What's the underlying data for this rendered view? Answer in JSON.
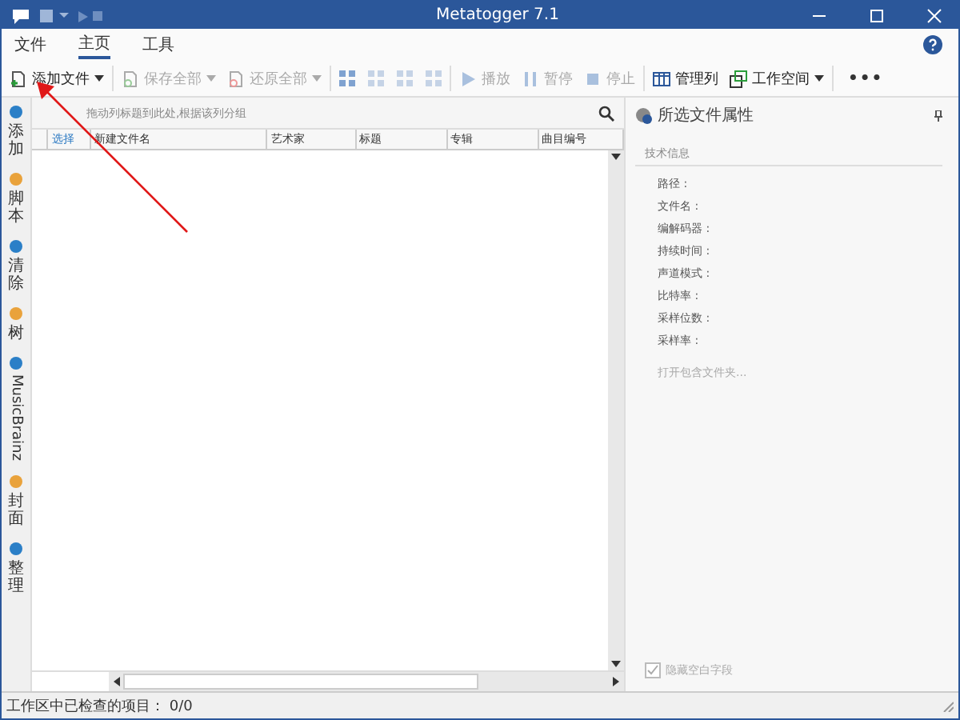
{
  "window": {
    "title": "Metatogger 7.1"
  },
  "menu_tabs": [
    {
      "label": "文件",
      "selected": false
    },
    {
      "label": "主页",
      "selected": true
    },
    {
      "label": "工具",
      "selected": false
    }
  ],
  "toolbar": [
    {
      "kind": "button",
      "label": "添加文件",
      "dropdown": true,
      "disabled": false
    },
    {
      "kind": "button",
      "label": "保存全部",
      "dropdown": true,
      "disabled": true
    },
    {
      "kind": "button",
      "label": "还原全部",
      "dropdown": true,
      "disabled": true
    },
    {
      "kind": "grid"
    },
    {
      "kind": "button",
      "label": "播放",
      "dropdown": false,
      "disabled": true
    },
    {
      "kind": "button",
      "label": "暂停",
      "dropdown": false,
      "disabled": true
    },
    {
      "kind": "button",
      "label": "停止",
      "dropdown": false,
      "disabled": true
    },
    {
      "kind": "button",
      "label": "管理列",
      "dropdown": false,
      "disabled": false
    },
    {
      "kind": "button",
      "label": "工作空间",
      "dropdown": true,
      "disabled": false
    },
    {
      "kind": "more",
      "label": "•••"
    }
  ],
  "sidebar": [
    {
      "label": "添加",
      "kind": "cjk"
    },
    {
      "label": "脚本",
      "kind": "cjk"
    },
    {
      "label": "清除",
      "kind": "cjk"
    },
    {
      "label": "树",
      "kind": "cjk"
    },
    {
      "label": "MusicBrainz",
      "kind": "latin"
    },
    {
      "label": "封面",
      "kind": "cjk"
    },
    {
      "label": "整理",
      "kind": "cjk"
    }
  ],
  "grid": {
    "group_hint": "拖动列标题到此处,根据该列分组",
    "columns": [
      "选择",
      "新建文件名",
      "艺术家",
      "标题",
      "专辑",
      "曲目编号"
    ]
  },
  "properties": {
    "title": "所选文件属性",
    "section": "技术信息",
    "fields": [
      "路径 :",
      "文件名 :",
      "编解码器 :",
      "持续时间 :",
      "声道模式 :",
      "比特率 :",
      "采样位数 :",
      "采样率 :"
    ],
    "link": "打开包含文件夹...",
    "hide_empty": {
      "label": "隐藏空白字段",
      "checked": true
    }
  },
  "status_bar": "工作区中已检查的项目： 0/0"
}
